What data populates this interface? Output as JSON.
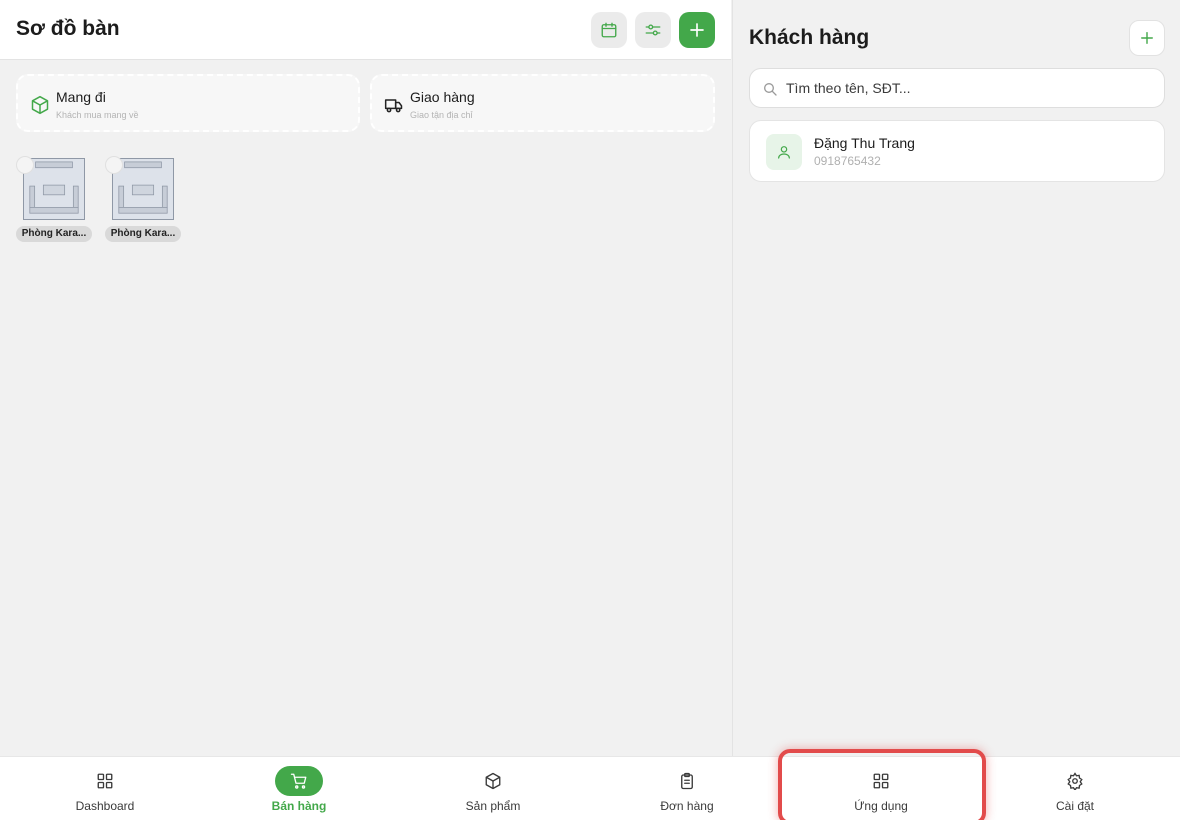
{
  "header": {
    "title": "Sơ đồ bàn"
  },
  "modes": [
    {
      "title": "Mang đi",
      "subtitle": "Khách mua mang về",
      "icon": "package-icon"
    },
    {
      "title": "Giao hàng",
      "subtitle": "Giao tận địa chỉ",
      "icon": "truck-icon"
    }
  ],
  "tables": [
    {
      "label": "Phòng Kara..."
    },
    {
      "label": "Phòng Kara..."
    }
  ],
  "customers": {
    "title": "Khách hàng",
    "search_placeholder": "Tìm theo tên, SĐT...",
    "list": [
      {
        "name": "Đặng Thu Trang",
        "phone": "0918765432"
      }
    ]
  },
  "nav": {
    "items": [
      {
        "label": "Dashboard",
        "icon": "grid-icon"
      },
      {
        "label": "Bán hàng",
        "icon": "cart-icon"
      },
      {
        "label": "Sản phẩm",
        "icon": "box-icon"
      },
      {
        "label": "Đơn hàng",
        "icon": "clipboard-icon"
      },
      {
        "label": "Ứng dụng",
        "icon": "apps-icon"
      },
      {
        "label": "Cài đặt",
        "icon": "gear-icon"
      }
    ],
    "active": "Bán hàng",
    "highlighted": "Ứng dụng"
  },
  "colors": {
    "accent": "#43a84a",
    "highlight": "#e24b4b"
  }
}
